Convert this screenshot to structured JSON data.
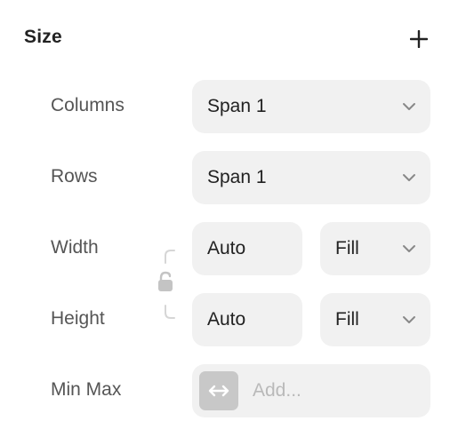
{
  "section": {
    "title": "Size"
  },
  "rows": {
    "columns": {
      "label": "Columns",
      "value": "Span 1"
    },
    "rows": {
      "label": "Rows",
      "value": "Span 1"
    },
    "width": {
      "label": "Width",
      "value": "Auto",
      "mode": "Fill"
    },
    "height": {
      "label": "Height",
      "value": "Auto",
      "mode": "Fill"
    },
    "minmax": {
      "label": "Min Max",
      "placeholder": "Add..."
    }
  },
  "icons": {
    "add": "plus-icon",
    "dropdown": "chevron-down-icon",
    "link": "unlocked-padlock-icon",
    "minmax": "horizontal-arrows-icon"
  },
  "colors": {
    "field_bg": "#f1f1f1",
    "label_text": "#555555",
    "placeholder_text": "#b9b9b9",
    "minmax_button": "#c8c8c8"
  }
}
